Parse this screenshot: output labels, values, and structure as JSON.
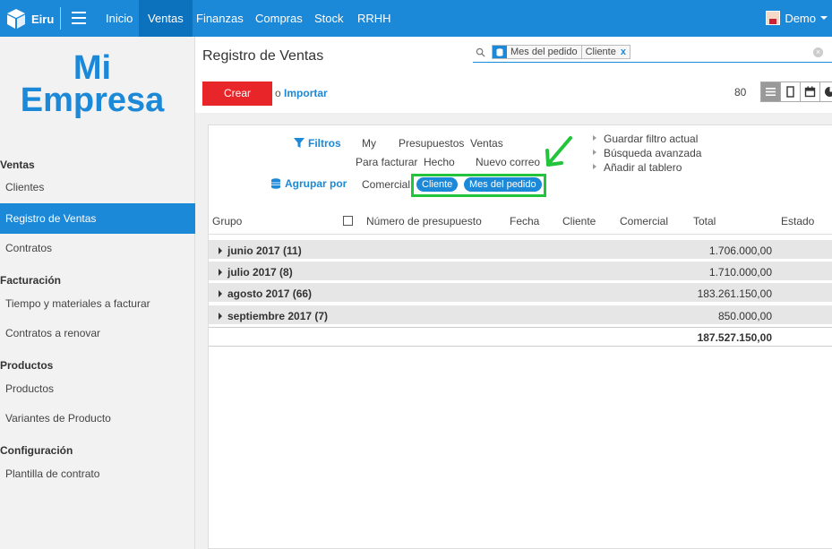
{
  "topbar": {
    "brand": "Eiru",
    "menu": [
      "Inicio",
      "Ventas",
      "Finanzas",
      "Compras",
      "Stock",
      "RRHH"
    ],
    "active_menu": "Ventas",
    "user": "Demo"
  },
  "sidebar": {
    "logo_line1": "Mi",
    "logo_line2": "Empresa",
    "sections": {
      "ventas": "Ventas",
      "facturacion": "Facturación",
      "productos": "Productos",
      "configuracion": "Configuración"
    },
    "items": {
      "clientes": "Clientes",
      "registro_ventas": "Registro de Ventas",
      "contratos": "Contratos",
      "tiempo_materiales": "Tiempo y materiales a facturar",
      "contratos_renovar": "Contratos a renovar",
      "productos": "Productos",
      "variantes": "Variantes de Producto",
      "plantilla": "Plantilla de contrato"
    }
  },
  "control": {
    "title": "Registro de Ventas",
    "facet_values": [
      "Mes del pedido",
      "Cliente"
    ],
    "facet_remove": "x",
    "create_label": "Crear",
    "import_prefix": "o",
    "import_label": "Importar",
    "pager": "80"
  },
  "search_menu": {
    "filters_label": "Filtros",
    "filters": [
      "My",
      "Presupuestos",
      "Ventas",
      "Para facturar",
      "Hecho",
      "Nuevo correo"
    ],
    "groupby_label": "Agrupar por",
    "groupby_plain": "Comercial",
    "groupby_active": [
      "Cliente",
      "Mes del pedido"
    ],
    "favorites": [
      "Guardar filtro actual",
      "Búsqueda avanzada",
      "Añadir al tablero"
    ]
  },
  "table": {
    "columns": [
      "Grupo",
      "Número de presupuesto",
      "Fecha",
      "Cliente",
      "Comercial",
      "Total",
      "Estado"
    ],
    "groups": [
      {
        "label": "junio 2017 (11)",
        "total": "1.706.000,00"
      },
      {
        "label": "julio 2017 (8)",
        "total": "1.710.000,00"
      },
      {
        "label": "agosto 2017 (66)",
        "total": "183.261.150,00"
      },
      {
        "label": "septiembre 2017 (7)",
        "total": "850.000,00"
      }
    ],
    "grand_total": "187.527.150,00"
  },
  "colors": {
    "primary": "#1c88d8",
    "create": "#e8262a",
    "highlight": "#21c43a"
  }
}
